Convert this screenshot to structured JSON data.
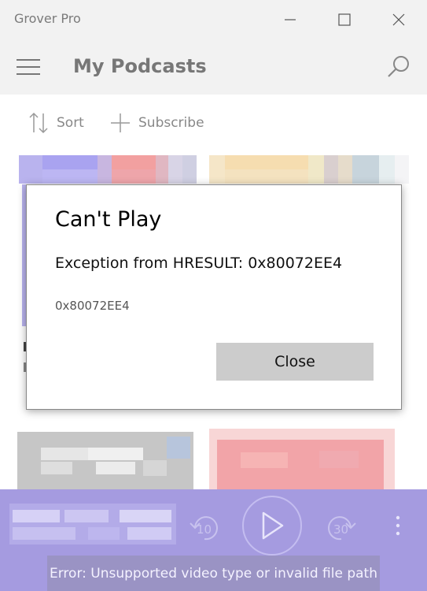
{
  "window": {
    "title": "Grover Pro",
    "minimize_icon": "minimize-icon",
    "maximize_icon": "maximize-icon",
    "close_icon": "close-icon"
  },
  "header": {
    "title": "My Podcasts",
    "menu_icon": "hamburger-icon",
    "search_icon": "search-icon"
  },
  "commands": {
    "sort_label": "Sort",
    "subscribe_label": "Subscribe"
  },
  "dialog": {
    "title": "Can't Play",
    "message": "Exception from HRESULT: 0x80072EE4",
    "code": "0x80072EE4",
    "close_label": "Close"
  },
  "player": {
    "rewind_seconds": "10",
    "forward_seconds": "30",
    "play_icon": "play-icon",
    "more_icon": "more-icon"
  },
  "toast": {
    "message": "Error: Unsupported video type or invalid file path"
  },
  "colors": {
    "chrome": "#f2f2f2",
    "player_bg": "#a59be0",
    "toast_bg": "#9a93c4",
    "dialog_button": "#cccccc"
  }
}
